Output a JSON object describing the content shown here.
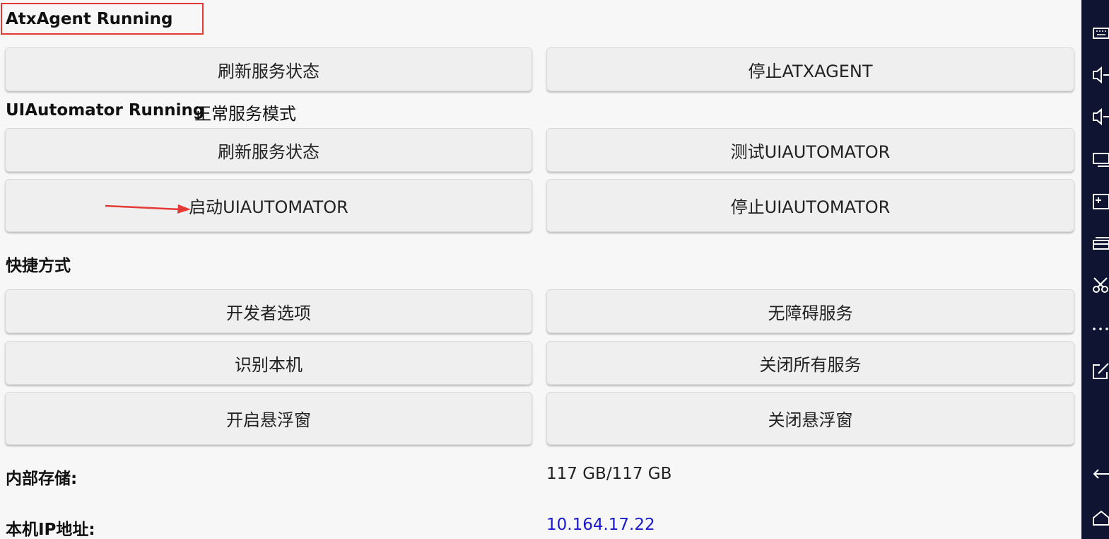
{
  "atx_agent": {
    "status": "AtxAgent Running",
    "refresh_label": "刷新服务状态",
    "stop_label": "停止ATXAGENT"
  },
  "uiautomator": {
    "status": "UIAutomator Running",
    "mode": "正常服务模式",
    "refresh_label": "刷新服务状态",
    "test_label": "测试UIAUTOMATOR",
    "start_label": "启动UIAUTOMATOR",
    "stop_label": "停止UIAUTOMATOR"
  },
  "shortcuts": {
    "title": "快捷方式",
    "developer_options": "开发者选项",
    "accessibility": "无障碍服务",
    "identify_device": "识别本机",
    "close_all_services": "关闭所有服务",
    "open_float_window": "开启悬浮窗",
    "close_float_window": "关闭悬浮窗"
  },
  "info": {
    "storage_label": "内部存储:",
    "storage_value": "117 GB/117 GB",
    "ip_label": "本机IP地址:",
    "ip_value": "10.164.17.22"
  },
  "sidebar": {
    "icons": [
      "keyboard-icon",
      "volume-down-icon",
      "volume-up-icon",
      "screen-icon",
      "app-add-icon",
      "layers-icon",
      "scissors-icon",
      "more-icon",
      "external-link-icon",
      "back-icon",
      "home-icon"
    ]
  },
  "colors": {
    "highlight_border": "#e53935",
    "arrow": "#e53935",
    "link": "#1a1acc",
    "sidebar_bg": "#0f1433"
  }
}
